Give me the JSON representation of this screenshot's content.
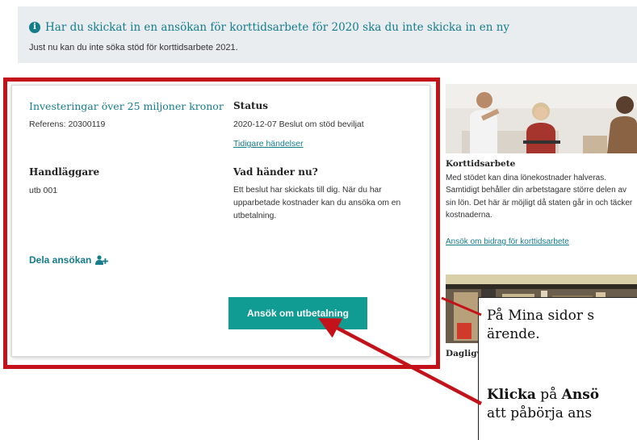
{
  "banner": {
    "title": "Har du skickat in en ansökan för korttidsarbete för 2020 ska du inte skicka in en ny",
    "subtitle": "Just nu kan du inte söka stöd för korttidsarbete 2021."
  },
  "case": {
    "title": "Investeringar över 25 miljoner kronor",
    "reference": "Referens: 20300119",
    "status_heading": "Status",
    "status_value": "2020-12-07 Beslut om stöd beviljat",
    "history_link": "Tidigare händelser",
    "handler_heading": "Handläggare",
    "handler_value": "utb 001",
    "next_heading": "Vad händer nu?",
    "next_text": "Ett beslut har skickats till dig. När du har upparbetade kostnader kan du ansöka om en utbetalning.",
    "share_label": "Dela ansökan",
    "apply_button": "Ansök om utbetalning"
  },
  "sidebar": {
    "card1_title": "Korttidsarbete",
    "card1_text": "Med stödet kan dina lönekostnader halveras. Samtidigt behåller din arbetstagare större delen av sin lön. Det här är möjligt då staten går in och täcker kostnaderna.",
    "card1_link": "Ansök om bidrag för korttidsarbete",
    "card2_title": "Dagligv"
  },
  "callout": {
    "line1_prefix": "På Mina sidor s",
    "line2": "ärende.",
    "line3_bold": "Klicka",
    "line3_mid": " på ",
    "line3_bold2": "Ansö",
    "line4": "att påbörja ans"
  },
  "colors": {
    "accent": "#157c8a",
    "button": "#109c92",
    "highlight": "#c4121a",
    "banner_bg": "#e9edf0"
  },
  "icons": [
    "info-icon",
    "add-person-icon"
  ]
}
